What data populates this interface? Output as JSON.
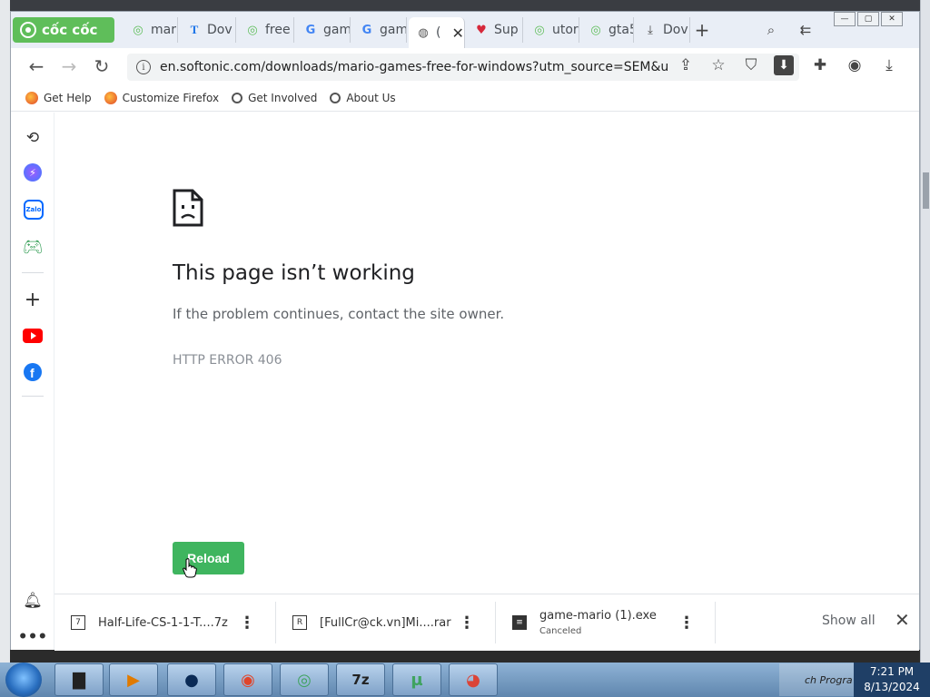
{
  "browser": {
    "brand": "cốc cốc",
    "tabs": [
      {
        "label": "mari",
        "icon": "coccoc-favicon"
      },
      {
        "label": "Dov",
        "icon": "t-favicon"
      },
      {
        "label": "free",
        "icon": "coccoc-favicon"
      },
      {
        "label": "gam",
        "icon": "google-favicon"
      },
      {
        "label": "gam",
        "icon": "google-favicon"
      },
      {
        "label": "(",
        "icon": "globe-favicon",
        "active": true
      },
      {
        "label": "Sup",
        "icon": "heart-favicon"
      },
      {
        "label": "utor",
        "icon": "coccoc-favicon"
      },
      {
        "label": "gta5",
        "icon": "coccoc-favicon"
      },
      {
        "label": "Dov",
        "icon": "download-favicon"
      }
    ],
    "url": "en.softonic.com/downloads/mario-games-free-for-windows?utm_source=SEM&utm_me...",
    "bookmarks": [
      {
        "label": "Get Help",
        "icon": "firefox-icon"
      },
      {
        "label": "Customize Firefox",
        "icon": "firefox-icon"
      },
      {
        "label": "Get Involved",
        "icon": "globe-icon"
      },
      {
        "label": "About Us",
        "icon": "globe-icon"
      }
    ]
  },
  "error_page": {
    "title": "This page isn’t working",
    "subtitle": "If the problem continues, contact the site owner.",
    "code": "HTTP ERROR 406",
    "reload_label": "Reload"
  },
  "downloads": {
    "items": [
      {
        "name": "Half-Life-CS-1-1-T....7z",
        "status": ""
      },
      {
        "name": "[FullCr@ck.vn]Mi....rar",
        "status": ""
      },
      {
        "name": "game-mario (1).exe",
        "status": "Canceled"
      }
    ],
    "show_all": "Show all"
  },
  "taskbar": {
    "tray_text": "ch Progra",
    "time": "7:21 PM",
    "date": "8/13/2024"
  },
  "colors": {
    "brand_green": "#5fbe5a",
    "reload_green": "#3fb55f"
  }
}
